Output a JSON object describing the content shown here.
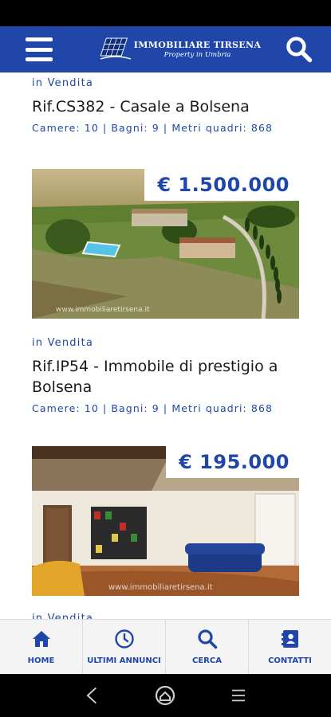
{
  "header": {
    "logo_name": "Immobiliare Tirsena",
    "logo_tagline": "Property in Umbria"
  },
  "listings": [
    {
      "status": "in Vendita",
      "title": "Rif.CS382 - Casale a Bolsena",
      "meta": "Camere: 10 | Bagni: 9 | Metri quadri: 868",
      "price": "€ 1.500.000",
      "watermark": "www.immobiliaretirsena.it"
    },
    {
      "status": "in Vendita",
      "title": "Rif.IP54 - Immobile di prestigio a Bolsena",
      "meta": "Camere: 10 | Bagni: 9 | Metri quadri: 868",
      "price": "€ 195.000",
      "watermark": "www.immobiliaretirsena.it"
    },
    {
      "status": "in Vendita"
    }
  ],
  "tabs": [
    {
      "label": "Home",
      "icon": "home-icon"
    },
    {
      "label": "Ultimi annunci",
      "icon": "clock-icon"
    },
    {
      "label": "Cerca",
      "icon": "search-icon"
    },
    {
      "label": "Contatti",
      "icon": "contact-book-icon"
    }
  ],
  "colors": {
    "brand_blue": "#1f46a8",
    "tab_bar_bg": "#f4f4f4"
  }
}
